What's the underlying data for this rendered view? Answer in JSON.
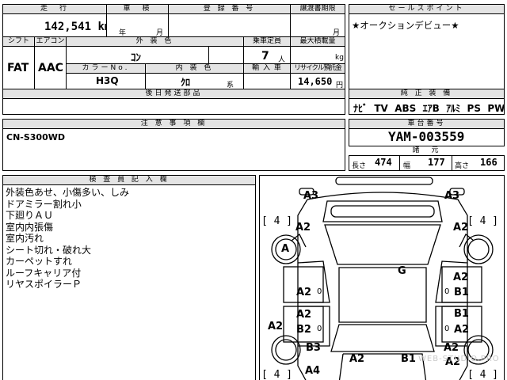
{
  "top": {
    "mileage_label": "走　行",
    "mileage_value": "142,541",
    "mileage_unit": "km",
    "inspection_label": "車　検",
    "inspection_year": "年",
    "inspection_month": "月",
    "registration_label": "登 録 番 号",
    "transfer_deadline_label": "譲渡書期限",
    "transfer_month": "月",
    "sales_point_label": "セールスポイント",
    "sales_point_text": "★オークションデビュー★"
  },
  "spec": {
    "shift_label": "シフト",
    "shift_value": "FAT",
    "aircon_label": "エアコン",
    "aircon_value": "AAC",
    "exterior_color_label": "外 装 色",
    "exterior_color_value": "ｺﾝ",
    "capacity_label": "乗車定員",
    "capacity_value": "7",
    "capacity_unit": "人",
    "load_label": "最大積載量",
    "load_unit": "kg",
    "color_no_label": "カラーNo.",
    "color_no_value": "H3Q",
    "interior_color_label": "内 装 色",
    "interior_color_value": "ｸﾛ",
    "interior_suffix": "系",
    "import_label": "輸 入 車",
    "recycle_label": "リサイクル預託金",
    "recycle_value": "14,650",
    "recycle_unit": "円",
    "later_parts_label": "後日発送部品"
  },
  "equipment": {
    "label": "純 正 装 備",
    "items": [
      "ﾅﾋﾞ",
      "TV",
      "ABS",
      "ｴｱB",
      "ｱﾙﾐ",
      "PS",
      "PW"
    ]
  },
  "notes": {
    "label": "注 意 事 項 欄",
    "text": "CN-S300WD"
  },
  "chassis": {
    "label": "車台番号",
    "value": "YAM-003559",
    "dims_label": "諸　元",
    "length_label": "長さ",
    "length_value": "474",
    "width_label": "幅",
    "width_value": "177",
    "height_label": "高さ",
    "height_value": "166"
  },
  "inspector": {
    "label": "検 査 員 記 入 欄",
    "lines": [
      "外装色あせ、小傷多い、しみ",
      "ドアミラー割れ小",
      "下廻りＡＵ",
      "室内内張傷",
      "室内汚れ",
      "シート切れ・破れ大",
      "カーペットすれ",
      "ルーフキャリア付",
      "リヤスポイラーＰ"
    ]
  },
  "diagram": {
    "marks": {
      "front_left_corner": "A3",
      "front_right_corner": "A3",
      "tire_fl": "[ 4 ]",
      "tire_fr": "[ 4 ]",
      "tire_rl": "[ 4 ]",
      "tire_rr": "[ 4 ]",
      "front_left_fender": "A2",
      "front_right_fender": "A2",
      "front_left_wheel": "A",
      "roof": "G",
      "right_front_door_a": "A2",
      "right_front_door_b": "B1",
      "left_front_door": "A2",
      "left_front_door_zero": "0",
      "right_front_door_zero": "0",
      "left_rear_door_a": "A2",
      "left_rear_door_b": "B2",
      "left_rear_door_zero": "0",
      "right_rear_door_b": "B1",
      "right_rear_door_a": "A2",
      "right_rear_door_zero": "0",
      "left_sill": "A2",
      "left_rear_fender": "B3",
      "right_rear_fender": "A2",
      "rear_left": "A2",
      "rear_center": "B1",
      "rear_left_corner": "A4",
      "rear_right_corner": "A2"
    },
    "watermark": "WEB-STUDIO.PRO"
  }
}
